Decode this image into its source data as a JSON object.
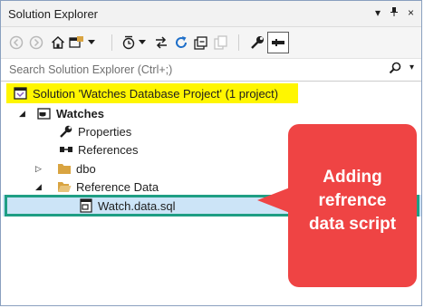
{
  "window": {
    "title": "Solution Explorer",
    "pin_glyph": "▾",
    "pin_icon_glyph": "ᵖ",
    "close_glyph": "×"
  },
  "toolbar": {
    "items": [
      "back-icon",
      "forward-icon",
      "home-icon",
      "switch-views-icon",
      "history-icon",
      "sync-icon",
      "refresh-icon",
      "collapse-all-icon",
      "show-all-files-icon",
      "properties-icon",
      "preview-icon"
    ]
  },
  "search": {
    "placeholder": "Search Solution Explorer (Ctrl+;)",
    "dropdown_glyph": "▾"
  },
  "tree": {
    "solution": "Solution 'Watches Database Project' (1 project)",
    "project": "Watches",
    "properties": "Properties",
    "references": "References",
    "dbo": "dbo",
    "reference_data": "Reference Data",
    "file": "Watch.data.sql"
  },
  "callout": {
    "lines": [
      "Adding",
      "refrence",
      "data script"
    ]
  },
  "colors": {
    "highlight": "#fff600",
    "callout": "#ef4444",
    "selection_border": "#1f9e84",
    "accent_icon": "#1e6fc9"
  }
}
